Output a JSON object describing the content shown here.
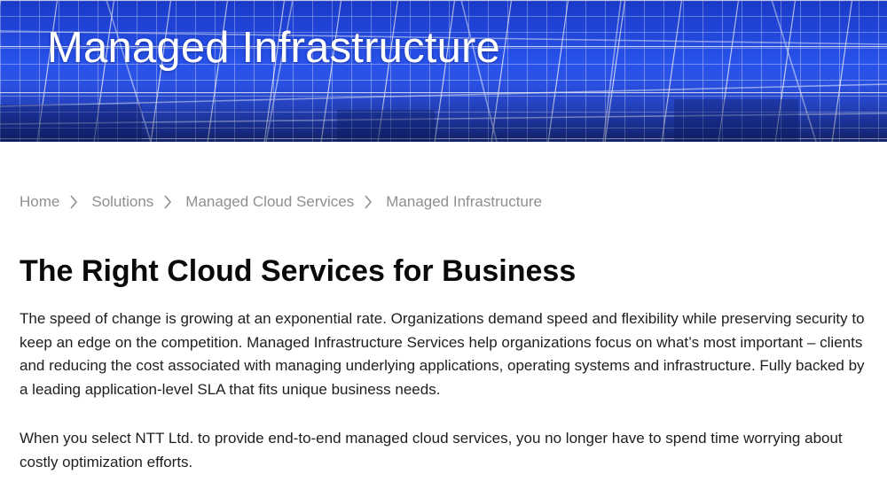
{
  "hero": {
    "title": "Managed Infrastructure"
  },
  "breadcrumb": {
    "items": [
      {
        "label": "Home"
      },
      {
        "label": "Solutions"
      },
      {
        "label": "Managed Cloud Services"
      },
      {
        "label": "Managed Infrastructure"
      }
    ]
  },
  "main": {
    "heading": "The Right Cloud Services for Business",
    "paragraph1": "The speed of change is growing at an exponential rate. Organizations demand speed and flexibility while preserving security to keep an edge on the competition.  Managed Infrastructure Services help organizations focus on what’s most important – clients and reducing the cost associated with managing underlying applications, operating systems and infrastructure. Fully backed by a leading application-level SLA that fits unique business needs.",
    "paragraph2": "When you select NTT Ltd. to provide end-to-end managed cloud services, you no longer have to spend time worrying about costly optimization efforts."
  },
  "colors": {
    "hero_blue": "#2a55f0",
    "breadcrumb_gray": "#8f8f8f",
    "heading_black": "#0a0a0a"
  }
}
